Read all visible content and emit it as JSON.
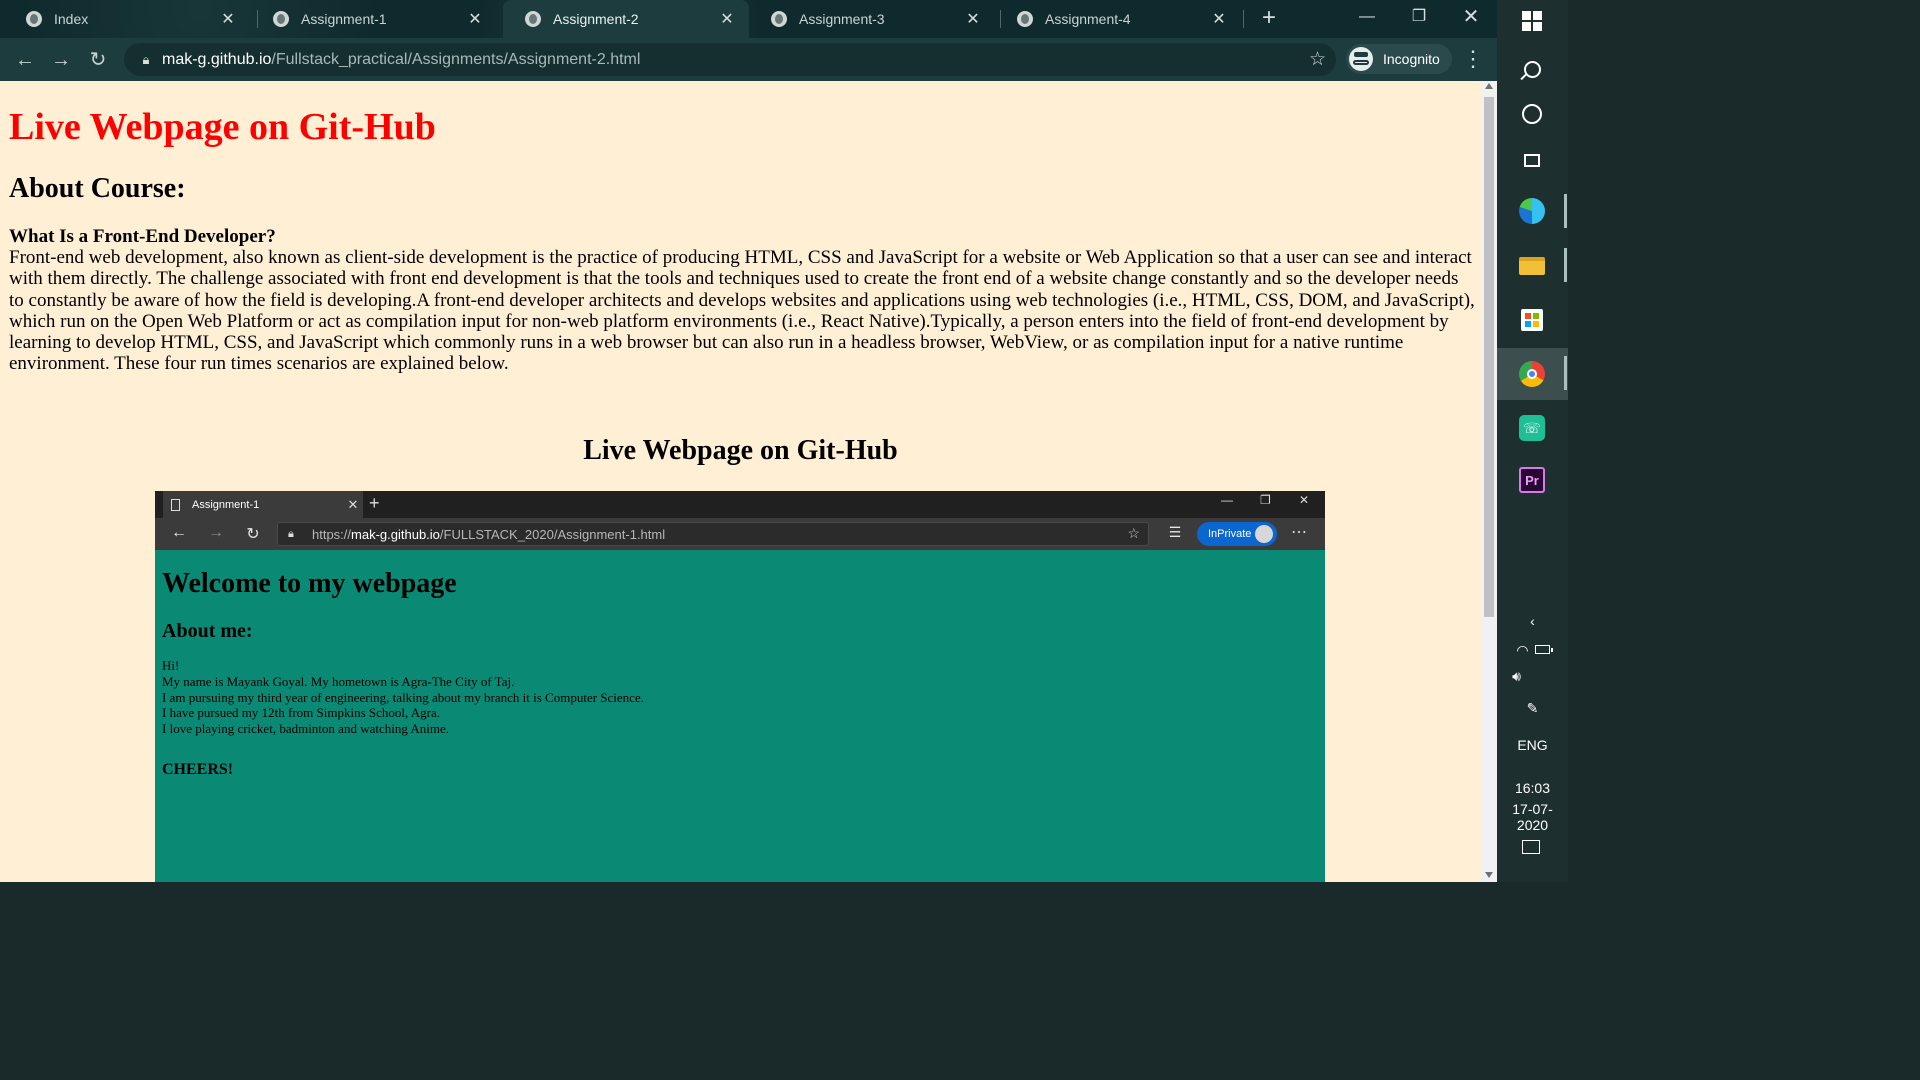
{
  "browser": {
    "tabs": [
      {
        "label": "Index",
        "active": false
      },
      {
        "label": "Assignment-1",
        "active": false
      },
      {
        "label": "Assignment-2",
        "active": true
      },
      {
        "label": "Assignment-3",
        "active": false
      },
      {
        "label": "Assignment-4",
        "active": false
      }
    ],
    "url_host": "mak-g.github.io",
    "url_path": "/Fullstack_practical/Assignments/Assignment-2.html",
    "profile_label": "Incognito"
  },
  "page": {
    "title": "Live Webpage on Git-Hub",
    "about_heading": "About Course:",
    "question_heading": "What Is a Front-End Developer?",
    "body_text": "Front-end web development, also known as client-side development is the practice of producing HTML, CSS and JavaScript for a website or Web Application so that a user can see and interact with them directly. The challenge associated with front end development is that the tools and techniques used to create the front end of a website change constantly and so the developer needs to constantly be aware of how the field is developing.A front-end developer architects and develops websites and applications using web technologies (i.e., HTML, CSS, DOM, and JavaScript), which run on the Open Web Platform or act as compilation input for non-web platform environments (i.e., React Native).Typically, a person enters into the field of front-end development by learning to develop HTML, CSS, and JavaScript which commonly runs in a web browser but can also run in a headless browser, WebView, or as compilation input for a native runtime environment. These four run times scenarios are explained below.",
    "section_heading": "Live Webpage on Git-Hub"
  },
  "embedded": {
    "tab_label": "Assignment-1",
    "url_scheme": "https://",
    "url_host": "mak-g.github.io",
    "url_path": "/FULLSTACK_2020/Assignment-1.html",
    "inprivate_label": "InPrivate",
    "heading": "Welcome to my webpage",
    "subheading": "About me:",
    "lines": [
      "Hi!",
      "My name is Mayank Goyal. My hometown is Agra-The City of Taj.",
      "I am pursuing my third year of engineering, talking about my branch it is Computer Science.",
      "I have pursued my 12th from Simpkins School, Agra.",
      "I love playing cricket, badminton and watching Anime."
    ],
    "closing": "CHEERS!",
    "bg_color": "#0a8a74"
  },
  "taskbar": {
    "language": "ENG",
    "time": "16:03",
    "date": "17-07-2020",
    "icons": [
      "windows-icon",
      "search-icon",
      "cortana-icon",
      "task-view-icon",
      "edge-icon",
      "file-explorer-icon",
      "store-icon",
      "chrome-icon",
      "whatsapp-icon",
      "premiere-icon"
    ]
  },
  "colors": {
    "page_bg": "#ffefd5",
    "title_red": "#ff0000",
    "chrome_frame": "#1d3c3e"
  }
}
